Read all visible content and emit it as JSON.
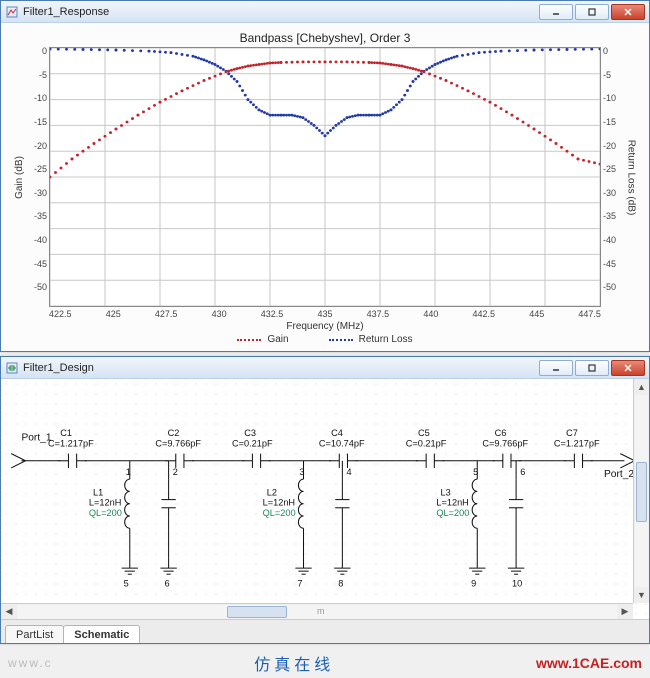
{
  "response_window": {
    "title": "Filter1_Response"
  },
  "design_window": {
    "title": "Filter1_Design"
  },
  "chart": {
    "title": "Bandpass [Chebyshev], Order 3",
    "xlabel": "Frequency (MHz)",
    "ylabel_left": "Gain (dB)",
    "ylabel_right": "Return Loss (dB)",
    "legend": {
      "gain": "Gain",
      "rl": "Return Loss"
    }
  },
  "chart_data": {
    "type": "line",
    "xlabel": "Frequency (MHz)",
    "ylabel_left": "Gain (dB)",
    "ylabel_right": "Return Loss (dB)",
    "xlim": [
      422.5,
      447.5
    ],
    "ylim": [
      -50,
      0
    ],
    "xticks": [
      "422.5",
      "425",
      "427.5",
      "430",
      "432.5",
      "435",
      "437.5",
      "440",
      "442.5",
      "445",
      "447.5"
    ],
    "yticks": [
      "0",
      "-5",
      "-10",
      "-15",
      "-20",
      "-25",
      "-30",
      "-35",
      "-40",
      "-45",
      "-50"
    ],
    "series": [
      {
        "name": "Gain",
        "color": "#c3242c",
        "x": [
          422.5,
          423.5,
          424.5,
          425.5,
          426.5,
          427.5,
          428.5,
          429.5,
          430.5,
          431,
          431.5,
          432,
          432.5,
          433,
          434,
          435,
          436,
          437,
          437.5,
          438,
          438.5,
          439,
          439.5,
          440.5,
          441.5,
          442.5,
          443.5,
          444.5,
          445.5,
          446.5,
          447.5
        ],
        "y": [
          -25,
          -21.5,
          -18.5,
          -15.7,
          -13,
          -10.5,
          -8.3,
          -6.3,
          -4.6,
          -4,
          -3.5,
          -3.2,
          -2.9,
          -2.8,
          -2.7,
          -2.7,
          -2.7,
          -2.8,
          -2.9,
          -3.2,
          -3.5,
          -4,
          -4.6,
          -6.3,
          -8.3,
          -10.5,
          -13,
          -15.7,
          -18.5,
          -21.5,
          -22.5
        ]
      },
      {
        "name": "Return Loss",
        "color": "#223aa6",
        "x": [
          422.5,
          424,
          425.5,
          427,
          428,
          429,
          429.5,
          430,
          430.5,
          431,
          431.5,
          432,
          432.5,
          433,
          433.5,
          434,
          434.5,
          435,
          435.5,
          436,
          436.5,
          437,
          437.5,
          438,
          438.5,
          439,
          439.5,
          440,
          440.5,
          441,
          442,
          443,
          444.5,
          446,
          447.5
        ],
        "y": [
          -0.2,
          -0.3,
          -0.4,
          -0.6,
          -0.9,
          -1.6,
          -2.3,
          -3.2,
          -4.5,
          -6.5,
          -10,
          -12,
          -13,
          -13,
          -13,
          -13.5,
          -15,
          -17,
          -15,
          -13.5,
          -13,
          -13,
          -13,
          -12,
          -10,
          -6.5,
          -4.5,
          -3.2,
          -2.3,
          -1.6,
          -0.9,
          -0.6,
          -0.4,
          -0.3,
          -0.2
        ]
      }
    ]
  },
  "schematic": {
    "ports": {
      "p1": "Port_1",
      "p2": "Port_2"
    },
    "components": {
      "c1": {
        "name": "C1",
        "value": "C=1.217pF"
      },
      "c2": {
        "name": "C2",
        "value": "C=9.766pF"
      },
      "c3": {
        "name": "C3",
        "value": "C=0.21pF"
      },
      "c4": {
        "name": "C4",
        "value": "C=10.74pF"
      },
      "c5": {
        "name": "C5",
        "value": "C=0.21pF"
      },
      "c6": {
        "name": "C6",
        "value": "C=9.766pF"
      },
      "c7": {
        "name": "C7",
        "value": "C=1.217pF"
      },
      "l1": {
        "name": "L1",
        "value": "L=12nH",
        "ql": "QL=200"
      },
      "l2": {
        "name": "L2",
        "value": "L=12nH",
        "ql": "QL=200"
      },
      "l3": {
        "name": "L3",
        "value": "L=12nH",
        "ql": "QL=200"
      }
    },
    "nodes": [
      "1",
      "2",
      "3",
      "4",
      "5",
      "6",
      "7",
      "8",
      "9",
      "10"
    ]
  },
  "tabs": {
    "partlist": "PartList",
    "schematic": "Schematic"
  },
  "footer": {
    "left": "www.c",
    "center": "仿真在线",
    "right": "www.1CAE.com"
  },
  "scroll_marker": "m"
}
